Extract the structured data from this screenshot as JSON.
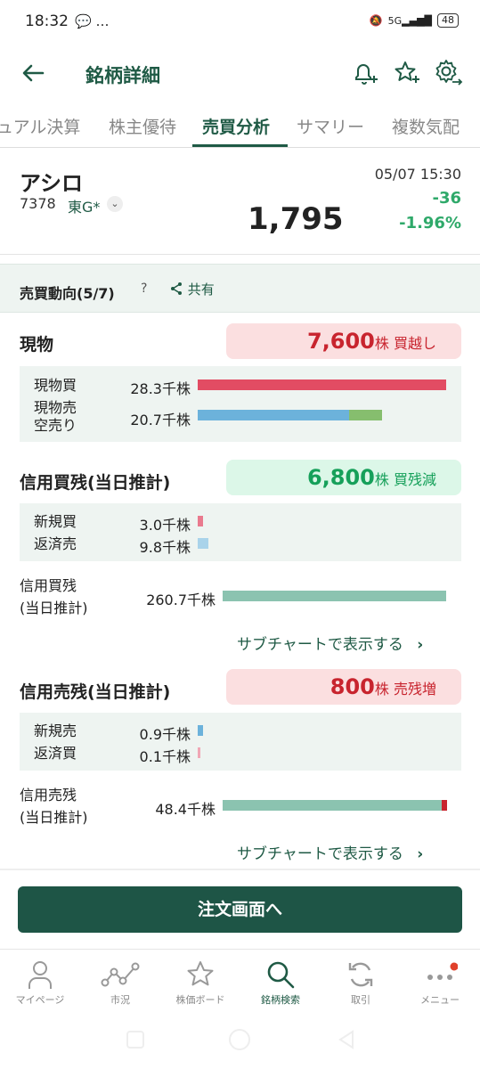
{
  "status": {
    "time": "18:32",
    "notif": "💬 …",
    "battery": "48"
  },
  "header": {
    "title": "銘柄詳細"
  },
  "tabs": [
    "ュアル決算",
    "株主優待",
    "売買分析",
    "サマリー",
    "複数気配"
  ],
  "stock": {
    "name": "アシロ",
    "code": "7378",
    "market": "東G*",
    "price": "1,795",
    "time": "05/07 15:30",
    "change": "-36",
    "change_pct": "-1.96%"
  },
  "section": {
    "label": "売買動向(5/7)",
    "help": "?",
    "share": "共有"
  },
  "genbutsu": {
    "title": "現物",
    "pill_value": "7,600",
    "pill_unit": "株",
    "pill_label": "買越し",
    "rows": [
      {
        "label": "現物買",
        "value": "28.3千株",
        "fraction": 1.0
      },
      {
        "label": "現物売\n空売り",
        "label1": "現物売",
        "label2": "空売り",
        "value": "20.7千株",
        "fraction": 0.74
      }
    ]
  },
  "margin_buy": {
    "title": "信用買残(当日推計)",
    "pill_value": "6,800",
    "pill_unit": "株",
    "pill_label": "買残減",
    "rows": [
      {
        "label": "新規買",
        "value": "3.0千株"
      },
      {
        "label": "返済売",
        "value": "9.8千株"
      }
    ],
    "total_label1": "信用買残",
    "total_label2": "(当日推計)",
    "total_value": "260.7千株",
    "link": "サブチャートで表示する"
  },
  "margin_sell": {
    "title": "信用売残(当日推計)",
    "pill_value": "800",
    "pill_unit": "株",
    "pill_label": "売残増",
    "rows": [
      {
        "label": "新規売",
        "value": "0.9千株"
      },
      {
        "label": "返済買",
        "value": "0.1千株"
      }
    ],
    "total_label1": "信用売残",
    "total_label2": "(当日推計)",
    "total_value": "48.4千株",
    "link": "サブチャートで表示する"
  },
  "cta": "注文画面へ",
  "nav": [
    {
      "label": "マイページ",
      "icon": "person-icon"
    },
    {
      "label": "市況",
      "icon": "market-graph-icon"
    },
    {
      "label": "株価ボード",
      "icon": "star-icon"
    },
    {
      "label": "銘柄検索",
      "icon": "search-icon"
    },
    {
      "label": "取引",
      "icon": "refresh-icon"
    },
    {
      "label": "メニュー",
      "icon": "more-icon"
    }
  ],
  "colors": {
    "brand": "#1f5a45",
    "up": "#c8242e",
    "down": "#16a05a",
    "bar_buy": "#e24c63",
    "bar_sell": "#6cb2db",
    "bar_short": "#86be6e",
    "bar_total": "#8bc3b0"
  }
}
